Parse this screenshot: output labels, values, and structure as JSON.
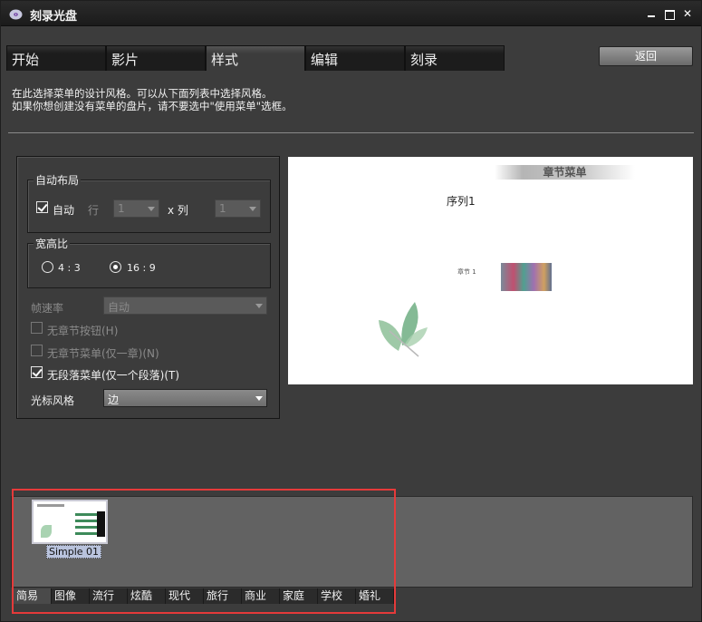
{
  "window": {
    "title": "刻录光盘"
  },
  "tabs": [
    {
      "label": "开始",
      "active": false
    },
    {
      "label": "影片",
      "active": false
    },
    {
      "label": "样式",
      "active": true
    },
    {
      "label": "编辑",
      "active": false
    },
    {
      "label": "刻录",
      "active": false
    }
  ],
  "back_button": "返回",
  "description": {
    "line1": "在此选择菜单的设计风格。可以从下面列表中选择风格。",
    "line2": "如果你想创建没有菜单的盘片，请不要选中\"使用菜单\"选框。"
  },
  "auto_layout": {
    "group_label": "自动布局",
    "auto_label": "自动",
    "auto_checked": true,
    "row_label": "行",
    "row_value": "1",
    "col_label": "x 列",
    "col_value": "1"
  },
  "aspect": {
    "group_label": "宽高比",
    "option_43": "4 : 3",
    "option_169": "16 : 9",
    "selected": "16:9"
  },
  "frame_rate": {
    "label": "帧速率",
    "value": "自动"
  },
  "checkboxes": {
    "no_chapter_button": {
      "label": "无章节按钮(H)",
      "checked": false
    },
    "no_chapter_menu": {
      "label": "无章节菜单(仅一章)(N)",
      "checked": false
    },
    "no_paragraph_menu": {
      "label": "无段落菜单(仅一个段落)(T)",
      "checked": true
    }
  },
  "cursor_style": {
    "label": "光标风格",
    "value": "边"
  },
  "preview": {
    "title": "章节菜单",
    "sequence": "序列1",
    "chapter": "章节 1"
  },
  "gallery": {
    "styles": [
      {
        "name": "Simple 01",
        "selected": true
      }
    ]
  },
  "categories": [
    "简易",
    "图像",
    "流行",
    "炫酷",
    "现代",
    "旅行",
    "商业",
    "家庭",
    "学校",
    "婚礼"
  ],
  "active_category": "简易",
  "colors": {
    "highlight": "#e53a3a",
    "panel": "#3c3c3c",
    "gallery": "#626262"
  }
}
